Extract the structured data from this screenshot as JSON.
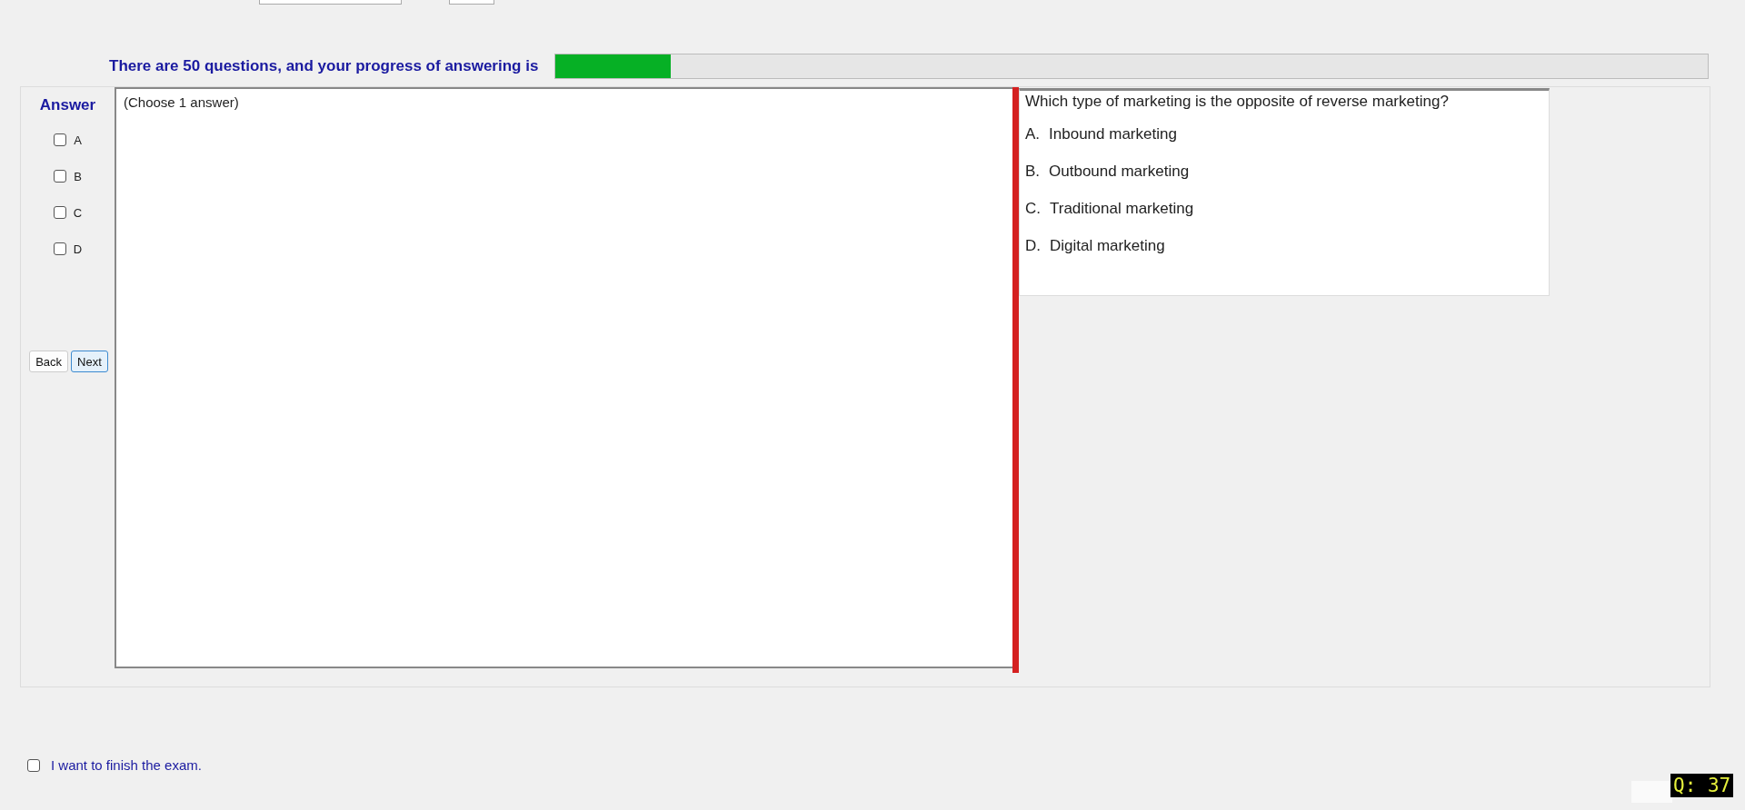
{
  "progress": {
    "label": "There are 50 questions, and your progress of answering is",
    "level": 0.1
  },
  "answer": {
    "title": "Answer",
    "options": [
      {
        "label": "A",
        "checked": false
      },
      {
        "label": "B",
        "checked": false
      },
      {
        "label": "C",
        "checked": false
      },
      {
        "label": "D",
        "checked": false
      }
    ]
  },
  "buttons": [
    {
      "label": "Back",
      "selected": false
    },
    {
      "label": "Next",
      "selected": true
    }
  ],
  "answer_area": {
    "hint": "(Choose 1 answer)"
  },
  "question": {
    "text": "Which type of marketing is the opposite of reverse marketing?",
    "choices": [
      {
        "letter": "A.",
        "text": "Inbound marketing"
      },
      {
        "letter": "B.",
        "text": "Outbound marketing"
      },
      {
        "letter": "C.",
        "text": "Traditional marketing"
      },
      {
        "letter": "D.",
        "text": "Digital marketing"
      }
    ]
  },
  "finish": {
    "label": "I want to finish the exam.",
    "checked": false
  },
  "question_number": "Q: 37"
}
